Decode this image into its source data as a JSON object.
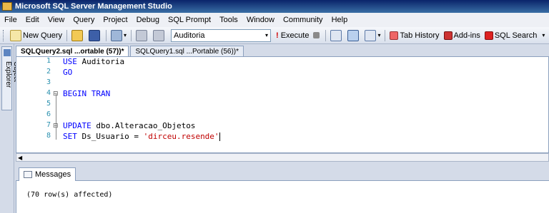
{
  "window": {
    "title": "Microsoft SQL Server Management Studio"
  },
  "menu": [
    "File",
    "Edit",
    "View",
    "Query",
    "Project",
    "Debug",
    "SQL Prompt",
    "Tools",
    "Window",
    "Community",
    "Help"
  ],
  "toolbar": {
    "new_query": "New Query",
    "database": "Auditoria",
    "execute": "Execute",
    "tab_history": "Tab History",
    "addins": "Add-ins",
    "sql_search": "SQL Search"
  },
  "sidebar": {
    "object_explorer": "Object Explorer"
  },
  "tabs": [
    {
      "label": "SQLQuery2.sql ...ortable (57))*",
      "active": true
    },
    {
      "label": "SQLQuery1.sql ...Portable (56))*",
      "active": false
    }
  ],
  "editor": {
    "lines": [
      {
        "num": "1",
        "tokens": [
          {
            "t": "USE ",
            "k": "kw"
          },
          {
            "t": "Auditoria",
            "k": "plain"
          }
        ]
      },
      {
        "num": "2",
        "tokens": [
          {
            "t": "GO",
            "k": "kw"
          }
        ]
      },
      {
        "num": "3",
        "tokens": []
      },
      {
        "num": "4",
        "tokens": [
          {
            "t": "BEGIN TRAN",
            "k": "kw"
          }
        ]
      },
      {
        "num": "5",
        "tokens": []
      },
      {
        "num": "6",
        "tokens": []
      },
      {
        "num": "7",
        "tokens": [
          {
            "t": "UPDATE ",
            "k": "kw"
          },
          {
            "t": "dbo.Alteracao_Objetos",
            "k": "plain"
          }
        ]
      },
      {
        "num": "8",
        "tokens": [
          {
            "t": "SET ",
            "k": "kw"
          },
          {
            "t": "Ds_Usuario = ",
            "k": "plain"
          },
          {
            "t": "'dirceu.resende'",
            "k": "str"
          }
        ]
      }
    ]
  },
  "results": {
    "tab_label": "Messages",
    "message": "(70 row(s) affected)"
  }
}
